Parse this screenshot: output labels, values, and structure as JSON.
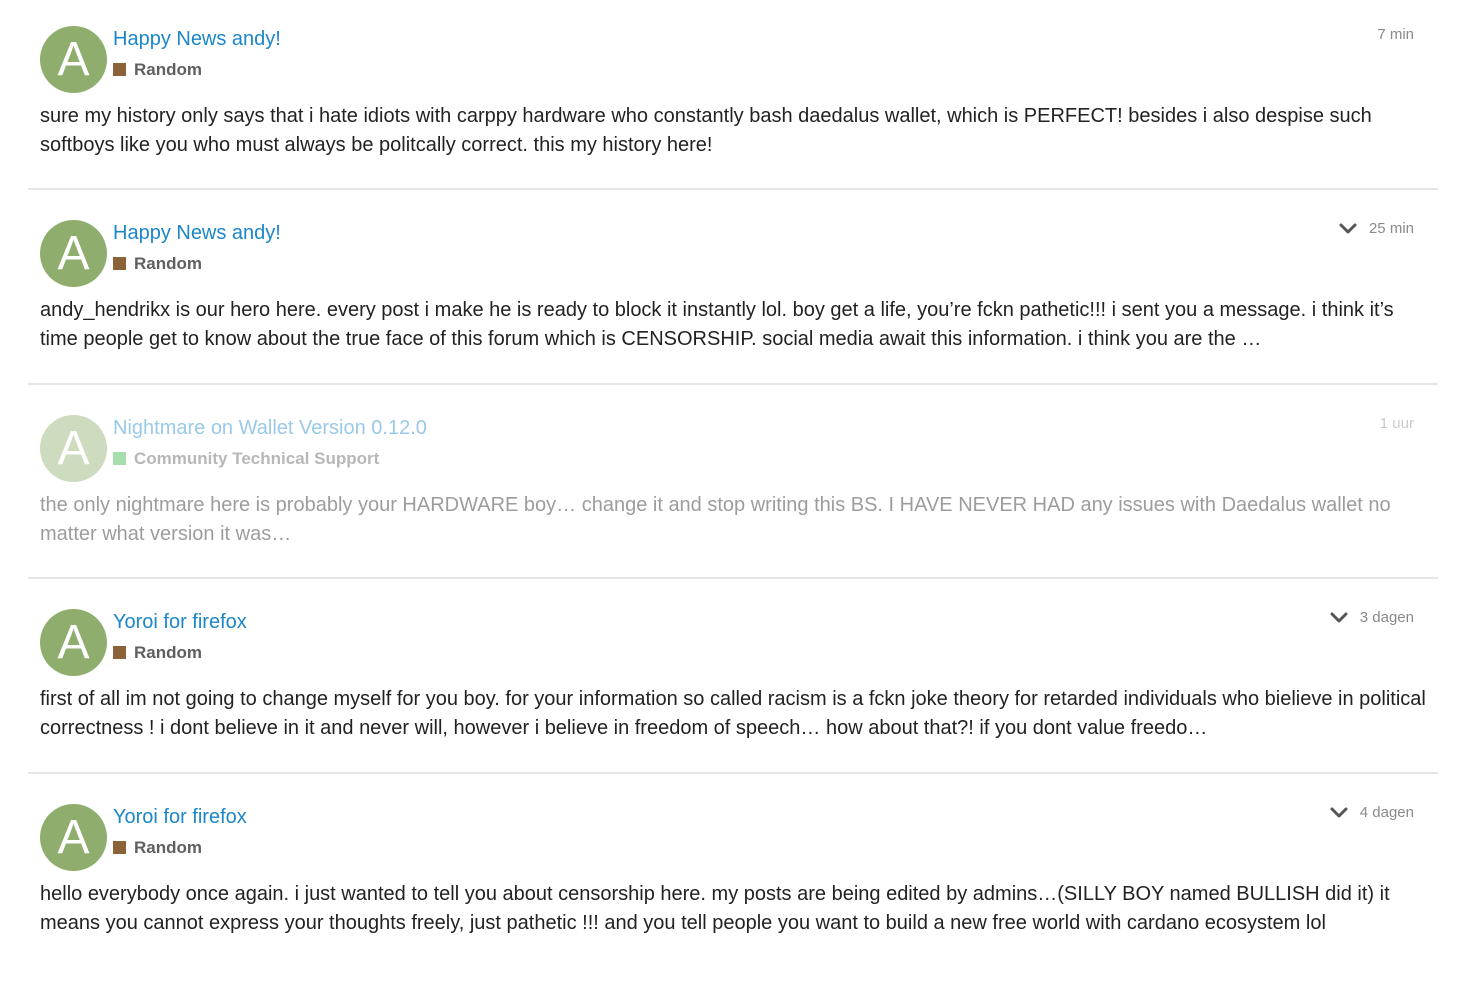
{
  "posts": [
    {
      "avatar_letter": "A",
      "title": "Happy News andy!",
      "category": "Random",
      "category_color": "#8c6238",
      "time": "7 min",
      "has_chevron": false,
      "faded": false,
      "excerpt": "sure my history only says that i hate idiots with carppy hardware who constantly bash daedalus wallet, which is PERFECT! besides i also despise such softboys like you who must always be politcally correct. this my history here!"
    },
    {
      "avatar_letter": "A",
      "title": "Happy News andy!",
      "category": "Random",
      "category_color": "#8c6238",
      "time": "25 min",
      "has_chevron": true,
      "faded": false,
      "excerpt": "andy_hendrikx is our hero here. every post i make he is ready to block it instantly lol. boy get a life, you’re fckn pathetic!!! i sent you a message. i think it’s time people get to know about the true face of this forum which is CENSORSHIP. social media await this information. i think you are the …"
    },
    {
      "avatar_letter": "A",
      "title": "Nightmare on Wallet Version 0.12.0",
      "category": "Community Technical Support",
      "category_color": "#3ab54a",
      "time": "1 uur",
      "has_chevron": false,
      "faded": true,
      "excerpt": "the only nightmare here is probably your HARDWARE boy… change it and stop writing this BS. I HAVE NEVER HAD any issues with Daedalus wallet no matter what version it was…"
    },
    {
      "avatar_letter": "A",
      "title": "Yoroi for firefox",
      "category": "Random",
      "category_color": "#8c6238",
      "time": "3 dagen",
      "has_chevron": true,
      "faded": false,
      "excerpt": "first of all im not going to change myself for you boy. for your information so called racism is a fckn joke theory for retarded individuals who bielieve in political correctness ! i dont believe in it and never will, however i believe in freedom of speech… how about that?! if you dont value freedo…"
    },
    {
      "avatar_letter": "A",
      "title": "Yoroi for firefox",
      "category": "Random",
      "category_color": "#8c6238",
      "time": "4 dagen",
      "has_chevron": true,
      "faded": false,
      "excerpt": "hello everybody once again. i just wanted to tell you about censorship here. my posts are being edited by admins…(SILLY BOY named BULLISH did it) it means you cannot express your thoughts freely, just pathetic !!! and you tell people you want to build a new free world with cardano ecosystem lol"
    }
  ]
}
